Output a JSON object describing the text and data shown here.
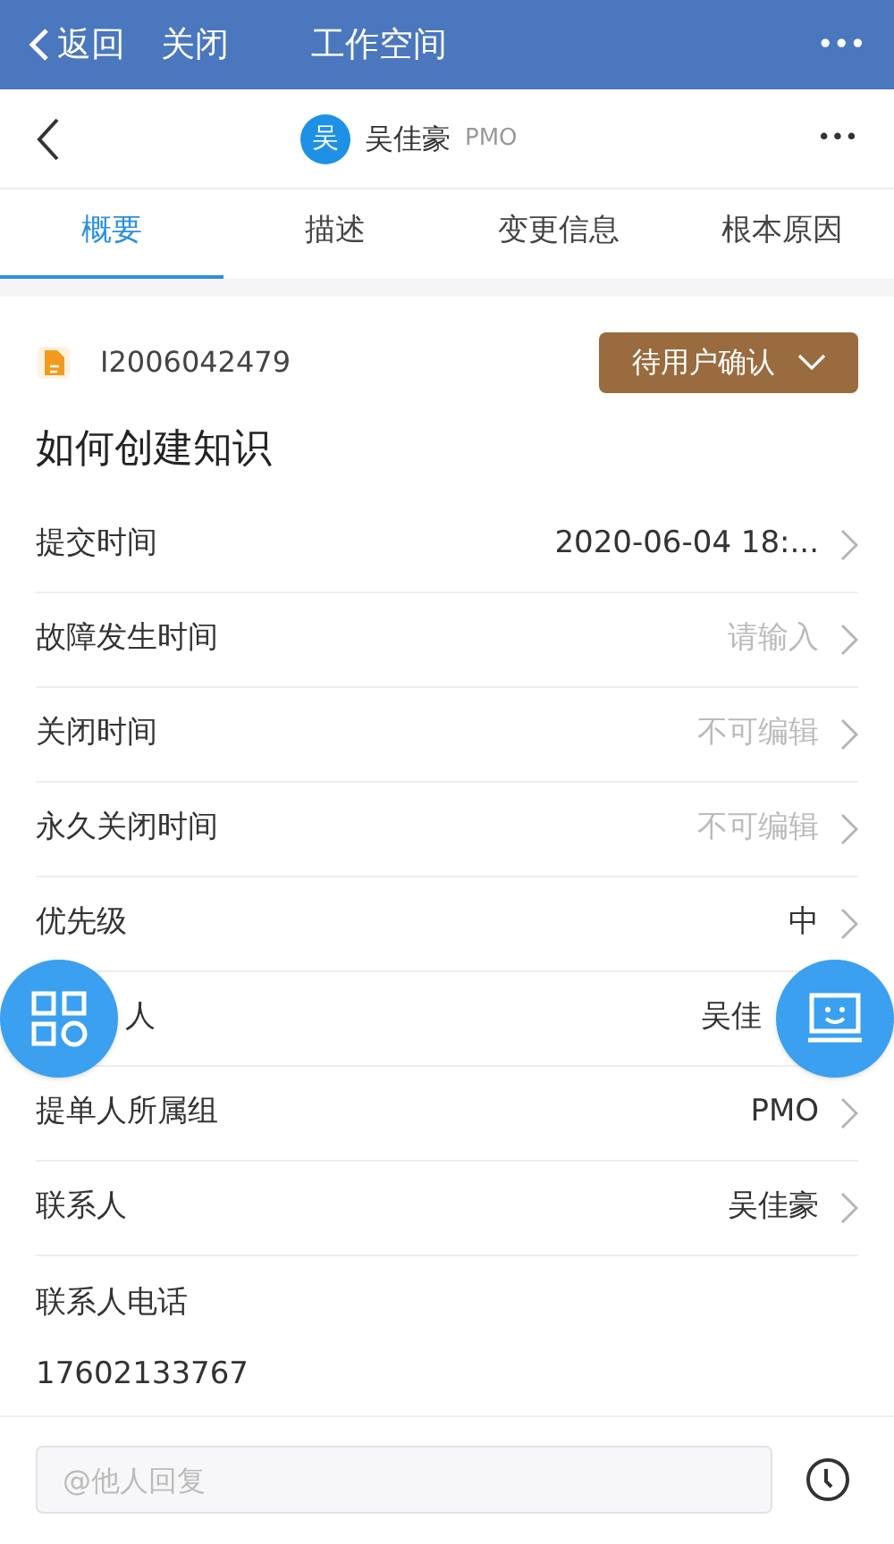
{
  "top_bar": {
    "back": "返回",
    "close": "关闭",
    "title": "工作空间",
    "more": "•••"
  },
  "header": {
    "avatar": "吴",
    "name": "吴佳豪",
    "group": "PMO",
    "more": "•••"
  },
  "tabs": [
    {
      "label": "概要",
      "selected": true
    },
    {
      "label": "描述",
      "selected": false
    },
    {
      "label": "变更信息",
      "selected": false
    },
    {
      "label": "根本原因",
      "selected": false
    }
  ],
  "ticket": {
    "id": "I2006042479",
    "status": "待用户确认",
    "title": "如何创建知识"
  },
  "fields": [
    {
      "kind": "row",
      "label": "提交时间",
      "value": "2020-06-04 18:...",
      "muted": false
    },
    {
      "kind": "row",
      "label": "故障发生时间",
      "value": "请输入",
      "muted": true
    },
    {
      "kind": "row",
      "label": "关闭时间",
      "value": "不可编辑",
      "muted": true
    },
    {
      "kind": "row",
      "label": "永久关闭时间",
      "value": "不可编辑",
      "muted": true
    },
    {
      "kind": "row",
      "label": "优先级",
      "value": "中",
      "muted": false
    },
    {
      "kind": "row",
      "label": "人",
      "value": "吴佳",
      "muted": false
    },
    {
      "kind": "row",
      "label": "提单人所属组",
      "value": "PMO",
      "muted": false
    },
    {
      "kind": "row",
      "label": "联系人",
      "value": "吴佳豪",
      "muted": false
    },
    {
      "kind": "stacked",
      "label": "联系人电话",
      "value": "17602133767",
      "muted": false
    }
  ],
  "reply": {
    "placeholder": "@他人回复"
  }
}
